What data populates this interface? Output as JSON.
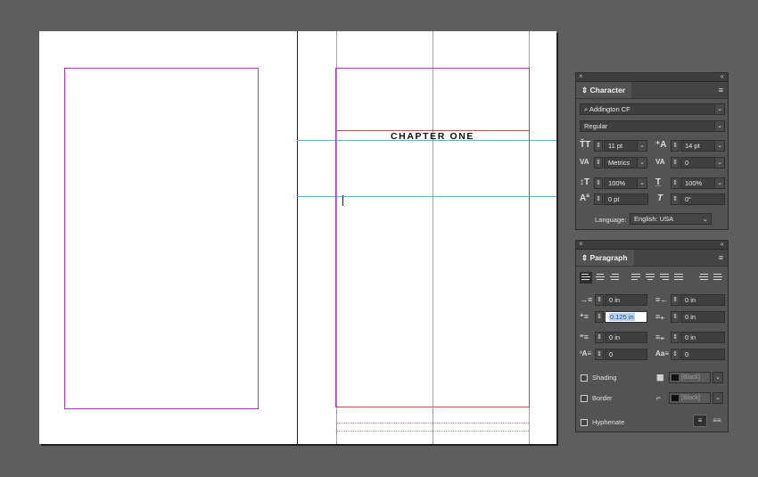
{
  "document": {
    "chapter_title": "CHAPTER ONE"
  },
  "character_panel": {
    "title": "Character",
    "font_family": "Addington CF",
    "font_style": "Regular",
    "font_size": "11 pt",
    "leading": "14 pt",
    "kerning": "Metrics",
    "tracking": "0",
    "vertical_scale": "100%",
    "horizontal_scale": "100%",
    "baseline_shift": "0 pt",
    "skew": "0°",
    "language_label": "Language:",
    "language_value": "English: USA"
  },
  "paragraph_panel": {
    "title": "Paragraph",
    "left_indent": "0 in",
    "right_indent": "0 in",
    "first_line_indent": "0.125 in",
    "last_line_indent": "0 in",
    "space_before": "0 in",
    "space_after": "0 in",
    "drop_cap_lines": "0",
    "drop_cap_chars": "0",
    "shading_label": "Shading",
    "shading_color": "[Black]",
    "border_label": "Border",
    "border_color": "[Black]",
    "hyphenate_label": "Hyphenate"
  },
  "colors": {
    "margin_guide": "#b030c8",
    "column_guide": "#39c6e6",
    "bleed_rule": "#c84a4a",
    "selection": "#b7d2f5"
  }
}
